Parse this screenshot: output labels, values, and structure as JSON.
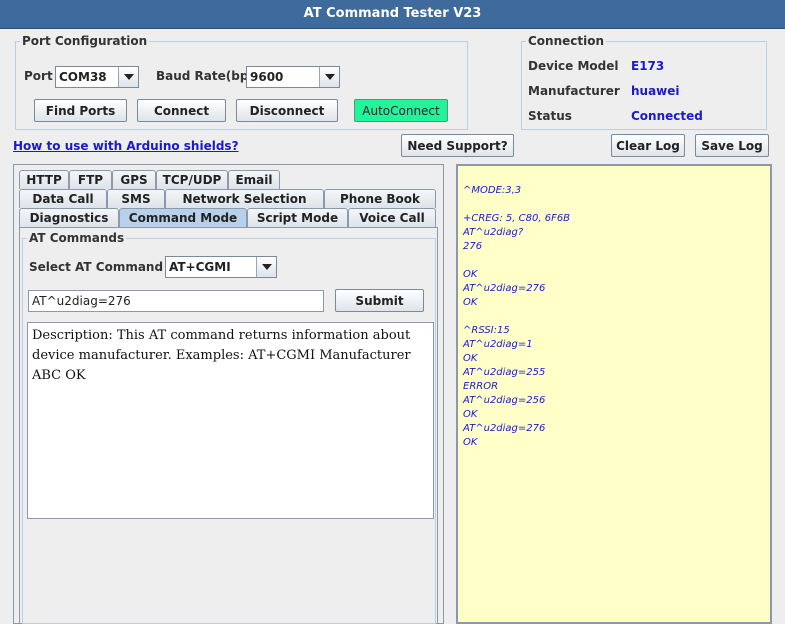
{
  "window": {
    "title": "AT Command Tester V23"
  },
  "port_config": {
    "legend": "Port Configuration",
    "port_label": "Port",
    "port_value": "COM38",
    "baud_label": "Baud Rate(bps)",
    "baud_value": "9600",
    "find_ports": "Find Ports",
    "connect": "Connect",
    "disconnect": "Disconnect",
    "autoconnect": "AutoConnect"
  },
  "connection": {
    "legend": "Connection",
    "device_model_label": "Device Model",
    "device_model_value": "E173",
    "manufacturer_label": "Manufacturer",
    "manufacturer_value": "huawei",
    "status_label": "Status",
    "status_value": "Connected"
  },
  "toolbar": {
    "arduino_link": "How to use with Arduino shields?",
    "need_support": "Need Support?",
    "clear_log": "Clear Log",
    "save_log": "Save Log"
  },
  "tabs": {
    "row1": [
      "HTTP",
      "FTP",
      "GPS",
      "TCP/UDP",
      "Email"
    ],
    "row2": [
      "Data Call",
      "SMS",
      "Network Selection",
      "Phone Book"
    ],
    "row3": [
      "Diagnostics",
      "Command Mode",
      "Script Mode",
      "Voice Call"
    ],
    "active": "Command Mode"
  },
  "at_commands": {
    "legend": "AT Commands",
    "select_label": "Select AT Command",
    "select_value": "AT+CGMI",
    "input_value": "AT^u2diag=276",
    "submit": "Submit",
    "description": "Description: This AT command returns information about device manufacturer. Examples: AT+CGMI Manufacturer ABC OK"
  },
  "log": {
    "lines": [
      "^MODE:3,3",
      "",
      "+CREG: 5, C80, 6F6B",
      "AT^u2diag?",
      "276",
      "",
      "OK",
      "AT^u2diag=276",
      "OK",
      "",
      "^RSSI:15",
      "AT^u2diag=1",
      "OK",
      "AT^u2diag=255",
      "ERROR",
      "AT^u2diag=256",
      "OK",
      "AT^u2diag=276",
      "OK"
    ]
  },
  "colors": {
    "titlebar": "#3e6a9c",
    "accent_value": "#1a1acc",
    "autoconnect": "#21f59a",
    "log_background": "#ffffc8",
    "active_tab": "#b8d0ea"
  }
}
